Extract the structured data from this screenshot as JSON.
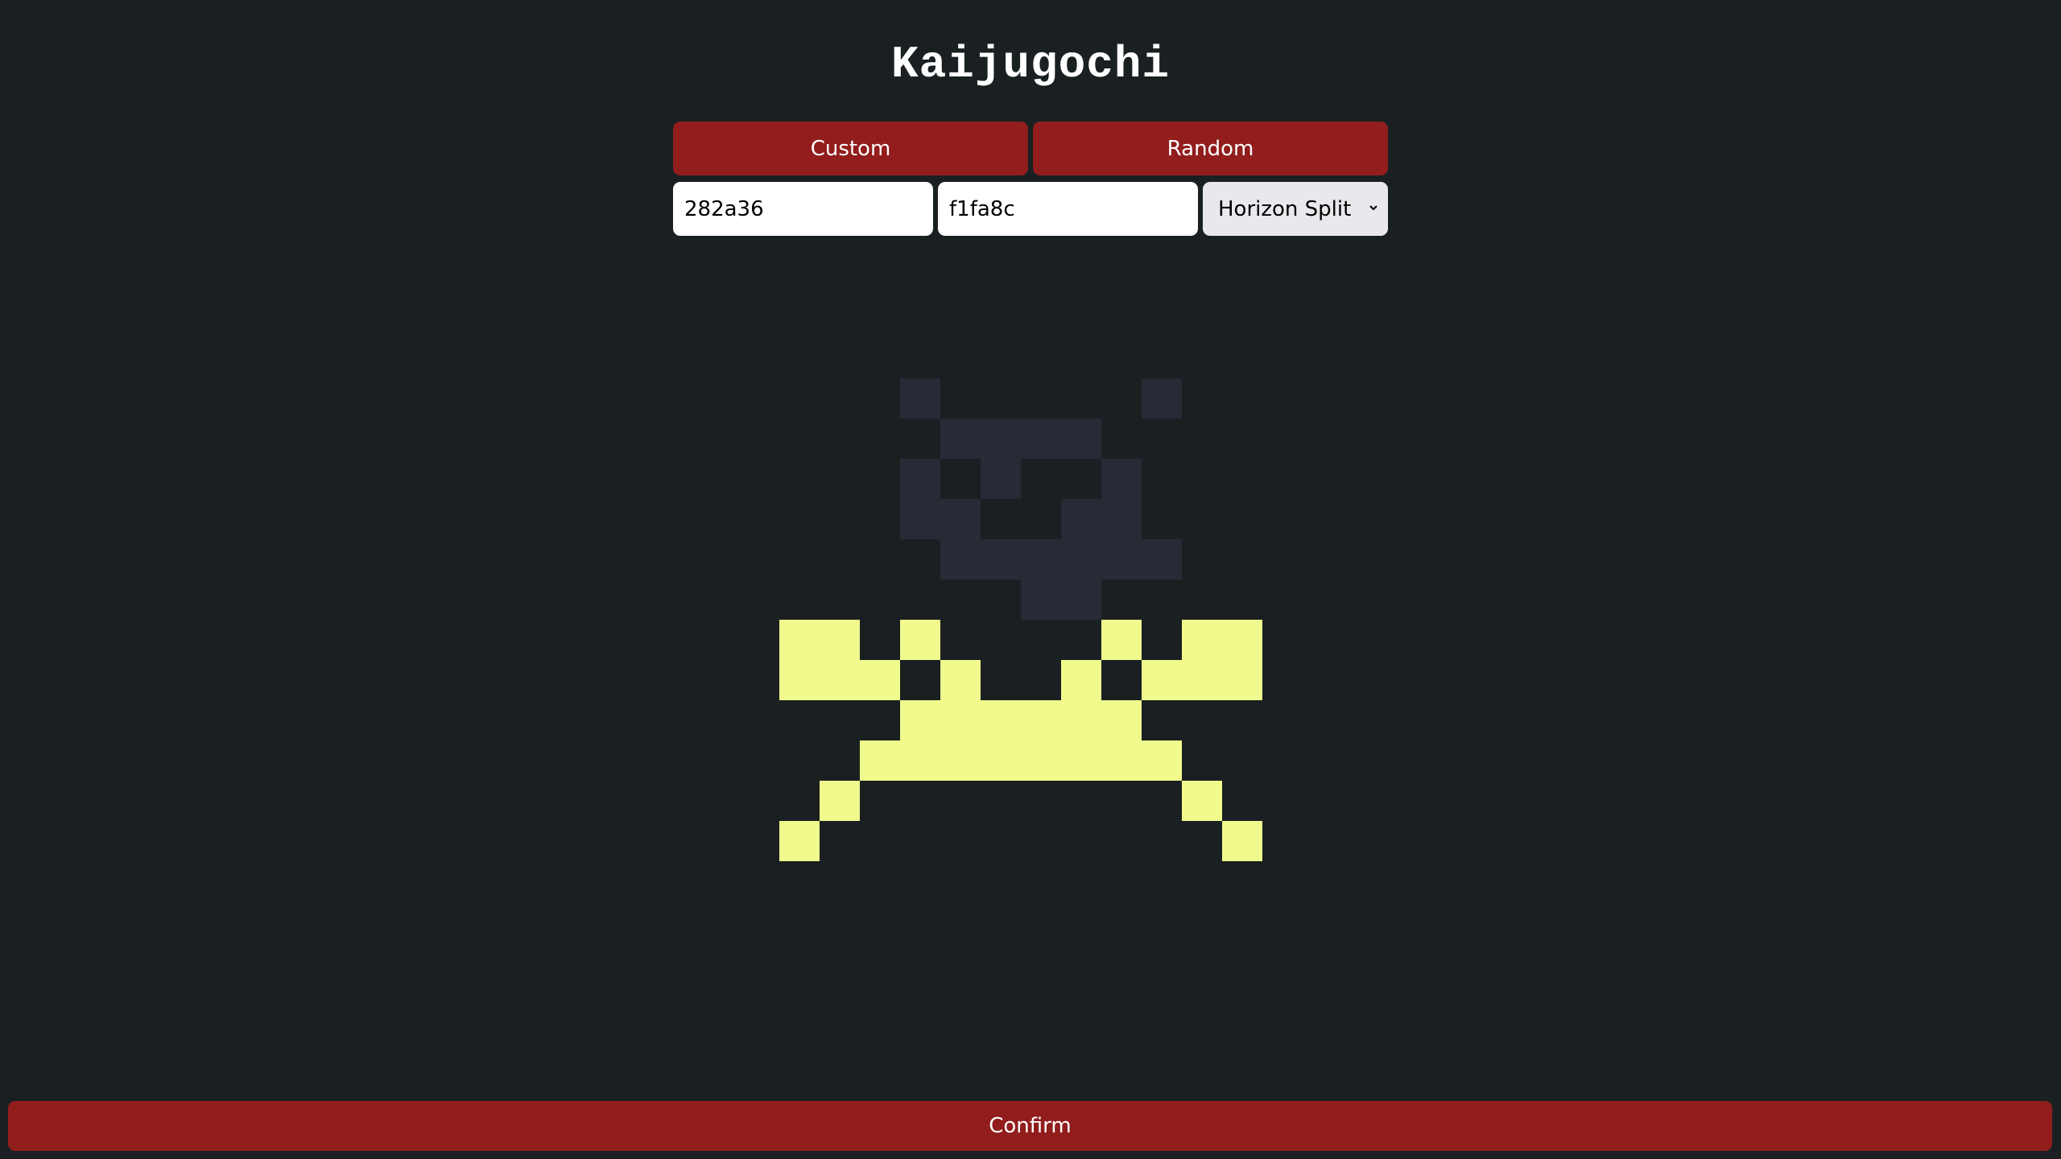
{
  "app": {
    "title": "Kaijugochi"
  },
  "mode_buttons": {
    "custom_label": "Custom",
    "random_label": "Random"
  },
  "colors": {
    "primary_value": "282a36",
    "secondary_value": "f1fa8c",
    "primary_hex": "#282a36",
    "secondary_hex": "#f1fa8c",
    "background_hex": "#1a2022",
    "accent_hex": "#921d1d"
  },
  "pattern_select": {
    "selected": "Horizon Split",
    "icon": "chevron-down-icon"
  },
  "sprite": {
    "grid_size": 12,
    "split_row": 6,
    "pixels": [
      "000100000100",
      "000011110000",
      "000101001000",
      "000110011000",
      "000011111100",
      "000000110000",
      "110100001011",
      "111010010111",
      "000111111000",
      "001111111100",
      "010000000010",
      "100000000001"
    ]
  },
  "confirm": {
    "label": "Confirm"
  }
}
